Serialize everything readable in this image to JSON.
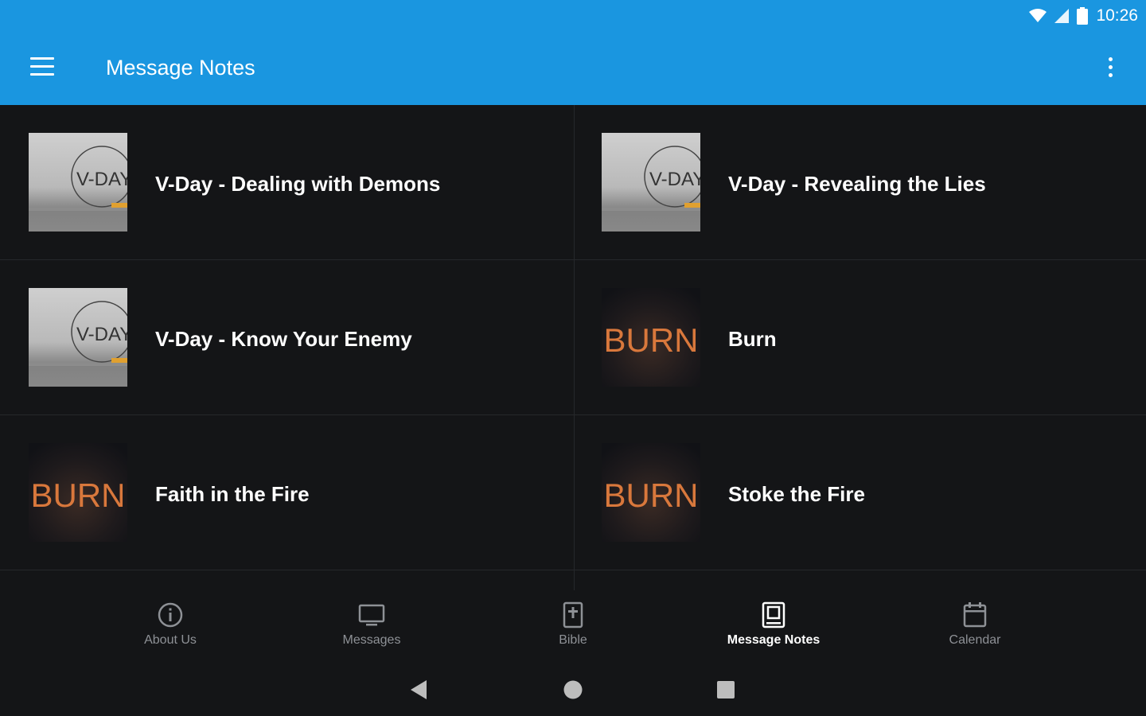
{
  "status_bar": {
    "time": "10:26"
  },
  "toolbar": {
    "title": "Message Notes"
  },
  "notes": [
    {
      "title": "V-Day - Dealing with Demons",
      "series": "V-DAY"
    },
    {
      "title": "V-Day - Revealing the Lies",
      "series": "V-DAY"
    },
    {
      "title": "V-Day - Know Your Enemy",
      "series": "V-DAY"
    },
    {
      "title": "Burn",
      "series": "BURN"
    },
    {
      "title": "Faith in the Fire",
      "series": "BURN"
    },
    {
      "title": "Stoke the Fire",
      "series": "BURN"
    }
  ],
  "bottom_nav": [
    {
      "label": "About Us",
      "icon": "info-icon"
    },
    {
      "label": "Messages",
      "icon": "monitor-icon"
    },
    {
      "label": "Bible",
      "icon": "bible-icon"
    },
    {
      "label": "Message Notes",
      "icon": "notes-icon",
      "active": true
    },
    {
      "label": "Calendar",
      "icon": "calendar-icon"
    }
  ],
  "colors": {
    "app_bar": "#1a96e0",
    "background": "#141517",
    "burn_text": "#d9783c"
  }
}
